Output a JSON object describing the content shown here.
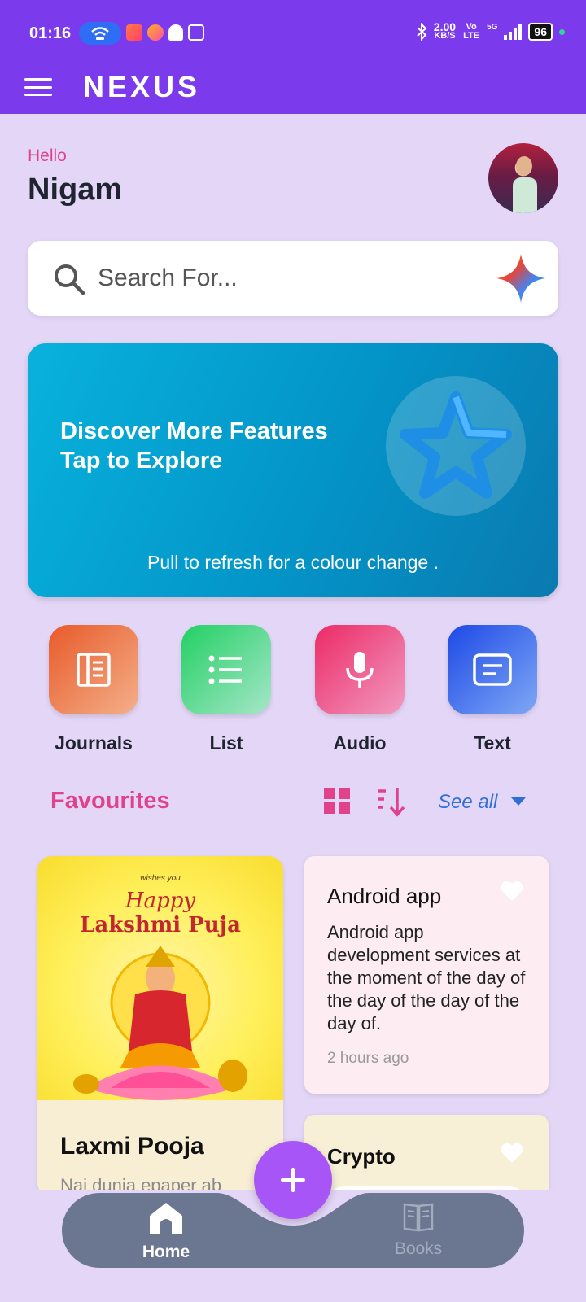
{
  "status_bar": {
    "time": "01:16",
    "net_speed_value": "2.00",
    "net_speed_unit": "KB/S",
    "volte": "Vo LTE",
    "network": "5G",
    "battery": "96"
  },
  "app_bar": {
    "title": "NEXUS"
  },
  "greeting": {
    "hello": "Hello",
    "name": "Nigam"
  },
  "search": {
    "placeholder": "Search For..."
  },
  "banner": {
    "line1": "Discover More Features",
    "line2": "Tap to Explore",
    "hint": "Pull to refresh for a colour change ."
  },
  "quick_actions": [
    {
      "label": "Journals",
      "icon": "journal-icon"
    },
    {
      "label": "List",
      "icon": "list-icon"
    },
    {
      "label": "Audio",
      "icon": "microphone-icon"
    },
    {
      "label": "Text",
      "icon": "text-note-icon"
    }
  ],
  "favourites": {
    "title": "Favourites",
    "see_all": "See all"
  },
  "cards": {
    "image_card": {
      "image_wishes": "wishes you",
      "image_happy": "Happy",
      "image_title": "Lakshmi Puja",
      "title": "Laxmi Pooja",
      "subtitle": "Nai dunia epaper ab"
    },
    "note_card": {
      "title": "Android app",
      "body": "Android app development services at the moment of the day of the day of the day of the day of.",
      "time": "2 hours ago"
    },
    "crypto_card": {
      "title": "Crypto"
    }
  },
  "bottom_nav": {
    "home": "Home",
    "books": "Books"
  },
  "colors": {
    "primary": "#7c3aed",
    "background": "#e4d6f7",
    "accent_pink": "#e0438c",
    "fab": "#a855f7",
    "nav_bar": "#6b7691"
  }
}
